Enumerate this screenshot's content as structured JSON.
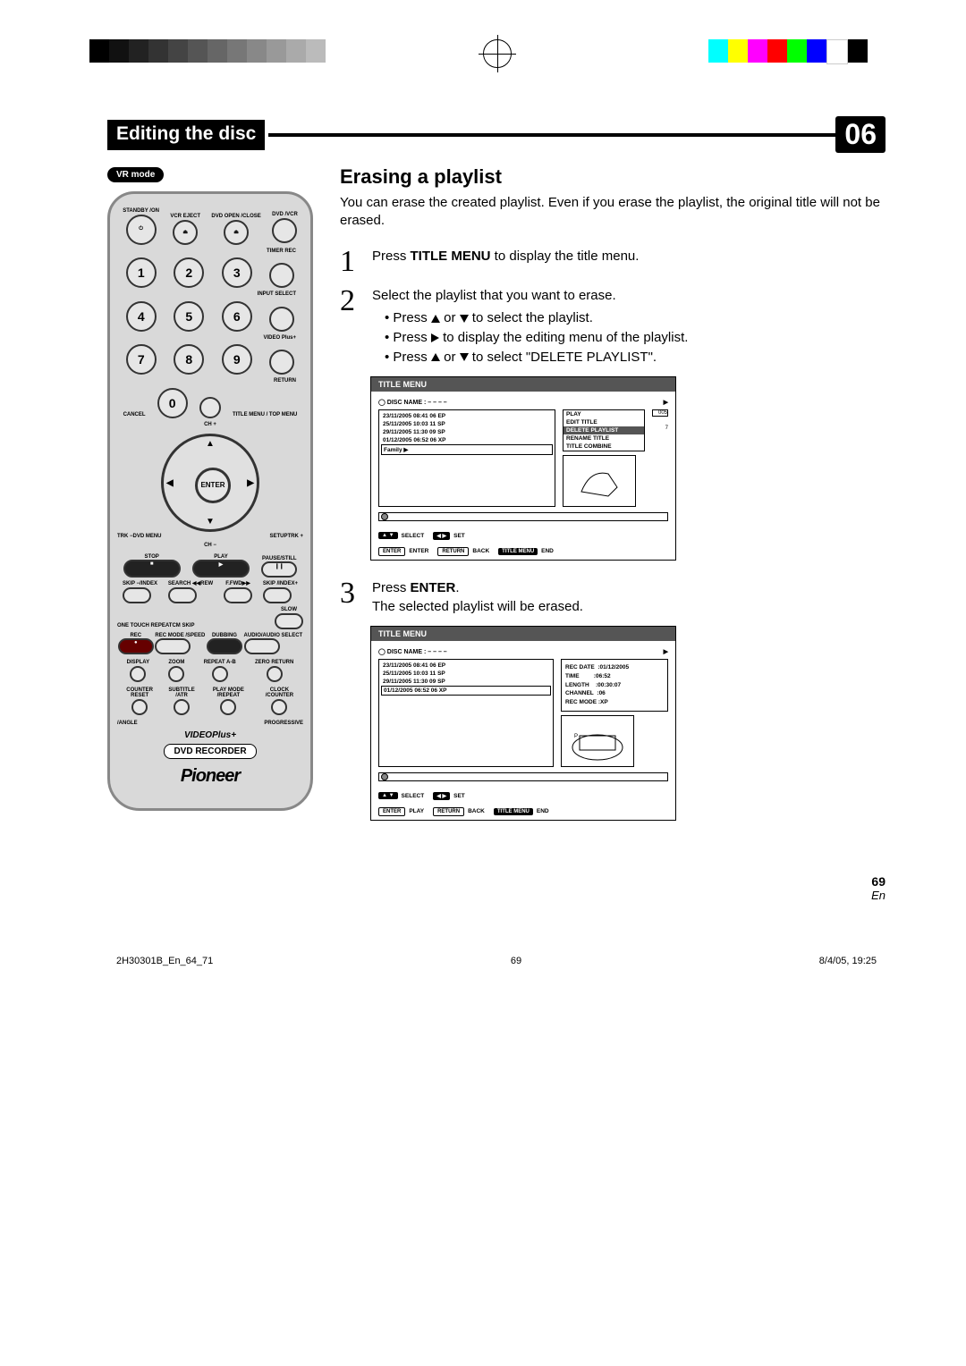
{
  "header": {
    "section_title": "Editing the disc",
    "chapter_num": "06"
  },
  "badges": {
    "vr_mode": "VR mode"
  },
  "remote": {
    "row1": {
      "standby": "STANDBY\n/ON",
      "vcr_eject": "VCR\nEJECT",
      "dvd_open": "DVD\nOPEN\n/CLOSE",
      "dvd_vcr": "DVD\n/VCR"
    },
    "extras": {
      "timer_rec": "TIMER REC",
      "input_select": "INPUT SELECT",
      "video_plus": "VIDEO Plus+",
      "return": "RETURN",
      "cancel": "CANCEL",
      "title_menu": "TITLE MENU\n/ TOP MENU"
    },
    "nums": [
      "1",
      "2",
      "3",
      "4",
      "5",
      "6",
      "7",
      "8",
      "9",
      "0"
    ],
    "dpad": {
      "ch_plus": "CH +",
      "ch_minus": "CH −",
      "trk_minus": "TRK\n−",
      "trk_plus": "TRK\n+",
      "enter": "ENTER",
      "dvd_menu": "DVD\nMENU",
      "setup": "SETUP"
    },
    "transport": {
      "stop": "STOP",
      "play": "PLAY",
      "pause": "PAUSE/STILL",
      "skip_minus": "SKIP\n−/INDEX",
      "search_rew": "SEARCH\n◀◀REW",
      "search_fwd": "F.FWD▶▶",
      "skip_plus": "SKIP\n/INDEX+",
      "one_touch": "ONE TOUCH\nREPEAT",
      "cm_skip": "CM SKIP",
      "slow": "SLOW"
    },
    "rec_row": {
      "rec": "REC",
      "rec_mode": "REC MODE\n/SPEED",
      "dubbing": "DUBBING",
      "audio": "AUDIO/AUDIO\nSELECT"
    },
    "small_row": {
      "display": "DISPLAY",
      "zoom": "ZOOM",
      "repeat_ab": "REPEAT A-B",
      "zero_return": "ZERO RETURN",
      "counter_reset": "COUNTER\nRESET",
      "subtitle": "SUBTITLE\n/ATR",
      "play_mode": "PLAY MODE\n/REPEAT",
      "clock": "CLOCK\n/COUNTER",
      "angle": "/ANGLE",
      "progressive": "PROGRESSIVE"
    },
    "bottom": {
      "videoplus": "VIDEOPlus+",
      "dvd_recorder": "DVD RECORDER",
      "brand": "Pioneer"
    }
  },
  "article": {
    "heading": "Erasing a playlist",
    "intro": "You can erase the created playlist. Even if you erase the playlist, the original title will not be erased.",
    "step1": {
      "num": "1",
      "prefix": "Press ",
      "bold": "TITLE MENU",
      "suffix": " to display the title menu."
    },
    "step2": {
      "num": "2",
      "line": "Select the playlist that you want to erase.",
      "b1a": "Press ",
      "b1b": " or ",
      "b1c": " to select the playlist.",
      "b2a": "Press ",
      "b2b": " to display the editing menu of the playlist.",
      "b3a": "Press ",
      "b3b": " or ",
      "b3c": " to select \"DELETE PLAYLIST\"."
    },
    "step3": {
      "num": "3",
      "prefix": "Press ",
      "bold": "ENTER",
      "suffix": ".",
      "line2": "The selected playlist will be erased."
    }
  },
  "menu1": {
    "title": "TITLE MENU",
    "disc_name_label": "DISC NAME :",
    "disc_name_value": "– – – –",
    "titles": [
      "23/11/2005 08:41 06 EP",
      "25/11/2005 10:03 11 SP",
      "29/11/2005 11:30 09 SP",
      "01/12/2005 06:52 06 XP",
      "Family                               ▶"
    ],
    "submenu": [
      "PLAY",
      "EDIT TITLE",
      "DELETE PLAYLIST",
      "RENAME TITLE",
      "TITLE COMBINE"
    ],
    "badge_r": "005",
    "badge_r2": "7",
    "nav": {
      "select": "SELECT",
      "set": "SET",
      "enter_k": "ENTER",
      "enter": "ENTER",
      "return_k": "RETURN",
      "back": "BACK",
      "title_k": "TITLE\nMENU",
      "end": "END"
    }
  },
  "menu2": {
    "title": "TITLE MENU",
    "disc_name_label": "DISC NAME :",
    "disc_name_value": "– – – –",
    "titles": [
      "23/11/2005 08:41 06 EP",
      "25/11/2005 10:03 11 SP",
      "29/11/2005 11:30 09 SP",
      "01/12/2005 06:52 06 XP"
    ],
    "details": {
      "rec_date_l": "REC DATE",
      "rec_date_v": ":01/12/2005",
      "time_l": "TIME",
      "time_v": ":06:52",
      "length_l": "LENGTH",
      "length_v": ":00:30:07",
      "channel_l": "CHANNEL",
      "channel_v": ":06",
      "rec_mode_l": "REC MODE",
      "rec_mode_v": ":XP"
    },
    "nav": {
      "select": "SELECT",
      "set": "SET",
      "enter_k": "ENTER",
      "play": "PLAY",
      "return_k": "RETURN",
      "back": "BACK",
      "title_k": "TITLE\nMENU",
      "end": "END"
    }
  },
  "page": {
    "num": "69",
    "lang": "En"
  },
  "footer": {
    "doc": "2H30301B_En_64_71",
    "page": "69",
    "date": "8/4/05, 19:25"
  }
}
